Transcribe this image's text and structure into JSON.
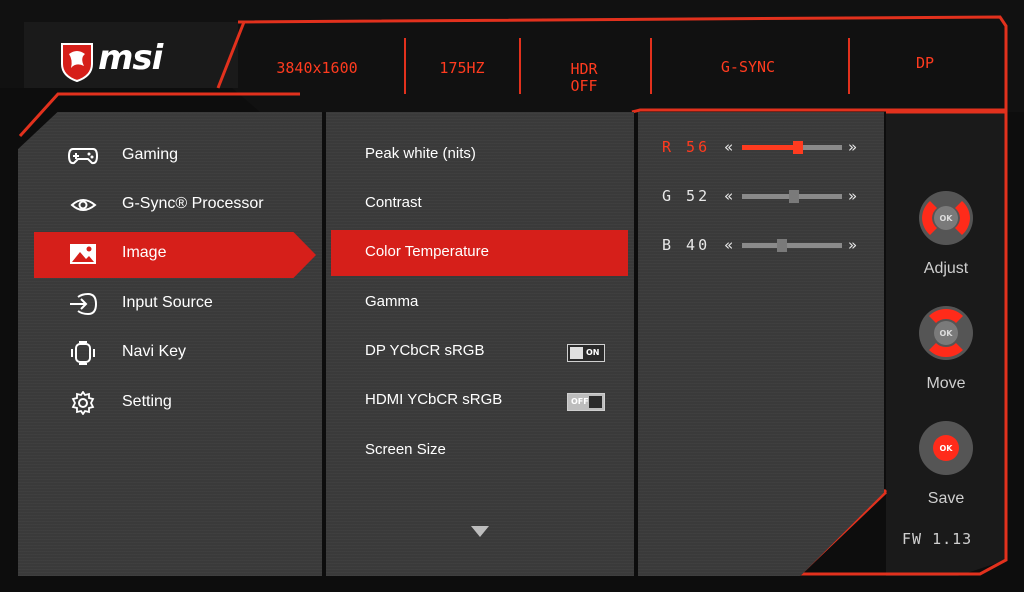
{
  "brand": {
    "logo_text": "msi"
  },
  "status_bar": {
    "resolution": "3840x1600",
    "refresh": "175HZ",
    "hdr_line1": "HDR",
    "hdr_line2": "OFF",
    "sync": "G-SYNC",
    "input": "DP"
  },
  "main_menu": [
    {
      "label": "Gaming",
      "icon": "gamepad-icon"
    },
    {
      "label": "G-Sync® Processor",
      "icon": "nvidia-icon"
    },
    {
      "label": "Image",
      "icon": "image-icon",
      "active": true
    },
    {
      "label": "Input Source",
      "icon": "input-source-icon"
    },
    {
      "label": "Navi Key",
      "icon": "navi-key-icon"
    },
    {
      "label": "Setting",
      "icon": "gear-icon"
    }
  ],
  "sub_menu": [
    {
      "label": "Peak white (nits)"
    },
    {
      "label": "Contrast"
    },
    {
      "label": "Color Temperature",
      "active": true
    },
    {
      "label": "Gamma"
    },
    {
      "label": "DP YCbCR sRGB",
      "toggle": "ON"
    },
    {
      "label": "HDMI YCbCR sRGB",
      "toggle": "OFF"
    },
    {
      "label": "Screen Size"
    }
  ],
  "color_temp": [
    {
      "label": "R 56",
      "value": 56,
      "active": true
    },
    {
      "label": "G 52",
      "value": 52
    },
    {
      "label": "B 40",
      "value": 40
    }
  ],
  "slider_glyphs": {
    "left": "«",
    "right": "»"
  },
  "nav_help": {
    "adjust": "Adjust",
    "move": "Move",
    "save": "Save",
    "ok": "OK"
  },
  "firmware": "FW  1.13",
  "colors": {
    "accent": "#e2311d",
    "active_bg": "#d61f1a",
    "panel": "#3a3a3a"
  }
}
